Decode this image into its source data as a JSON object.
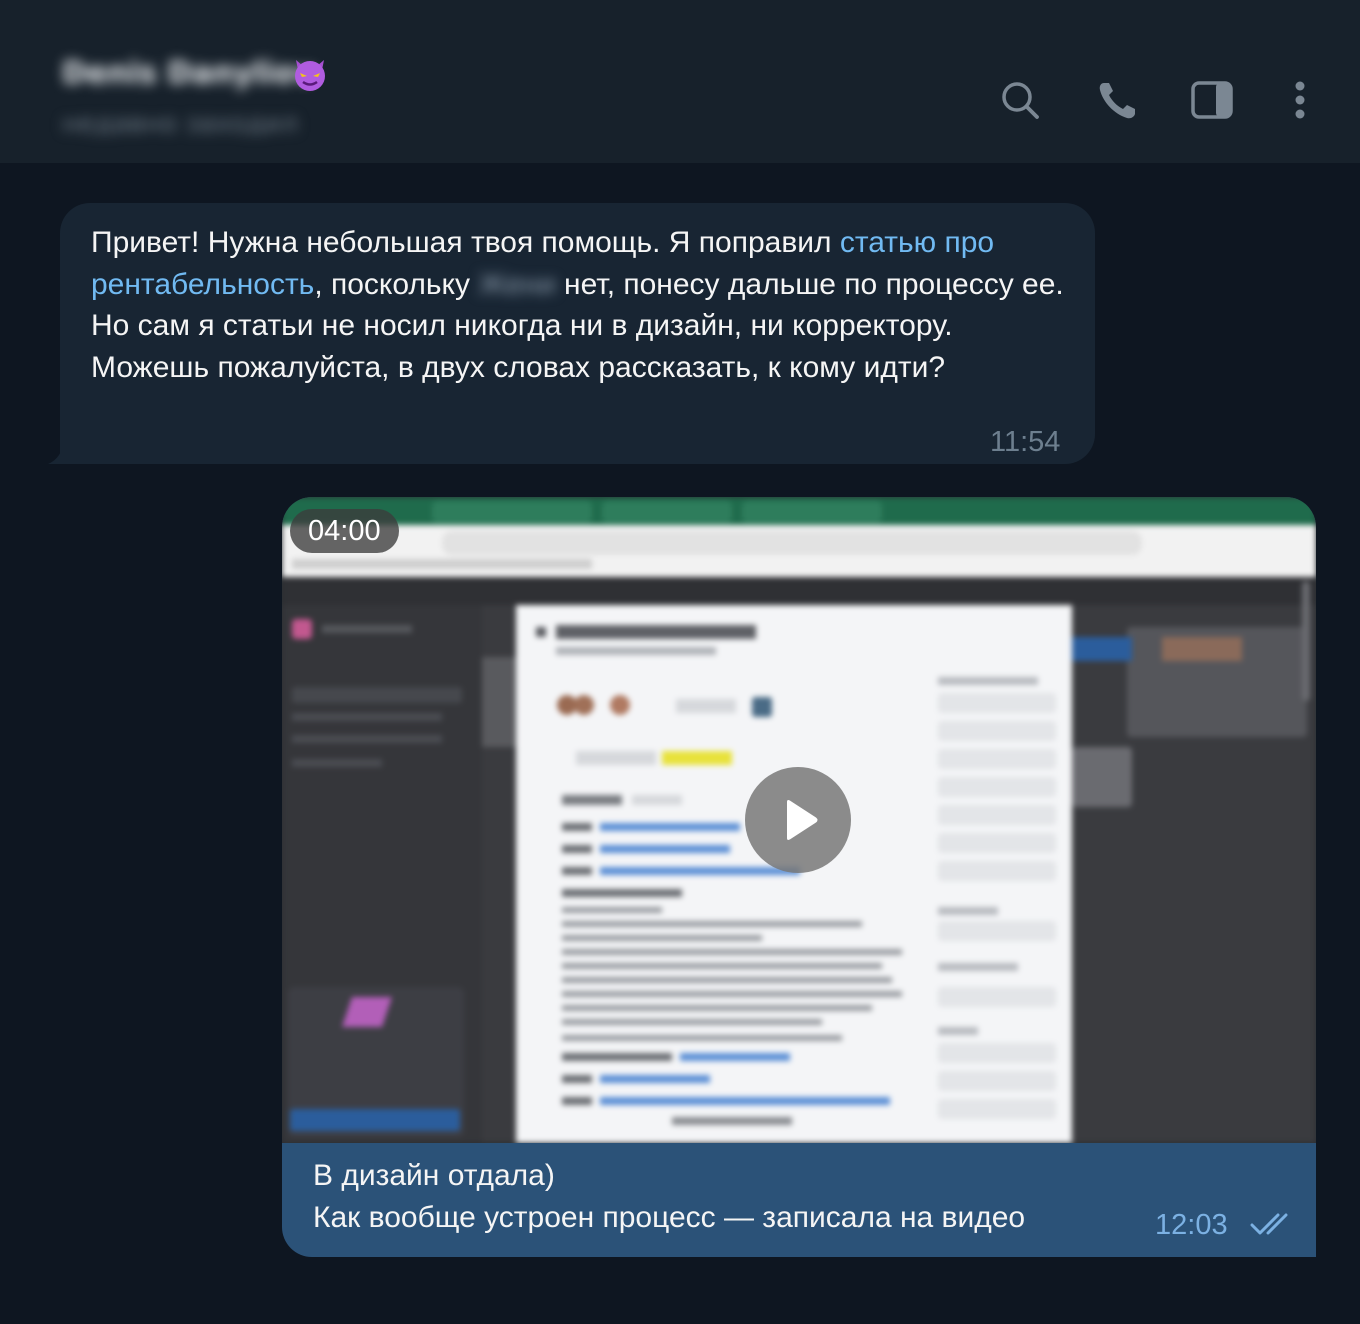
{
  "header": {
    "contact_name": "Denis Danyliov",
    "contact_status": "недавно заходил",
    "icons": [
      "search-icon",
      "phone-icon",
      "sidebar-toggle-icon",
      "more-vertical-icon"
    ]
  },
  "messages": {
    "incoming": {
      "text_before_link": "Привет! Нужна небольшая твоя помощь. Я поправил ",
      "link_text": "статью про рентабельность",
      "text_after_link": ", поскольку ",
      "redacted_name": "Жени",
      "text_after_name": " нет, понесу дальше по процессу ее. Но сам я статьи не носил никогда ни в дизайн, ни корректору. Можешь пожалуйста, в двух словах рассказать, к кому идти?",
      "time": "11:54"
    },
    "outgoing": {
      "video_duration": "04:00",
      "caption_line1": "В дизайн отдала)",
      "caption_line2": "Как вообще устроен процесс — записала на видео",
      "time": "12:03",
      "status": "read"
    }
  },
  "colors": {
    "background": "#0e1621",
    "header": "#17212b",
    "incoming_bubble": "#182533",
    "outgoing_bubble": "#2b5278",
    "link": "#71baf2"
  }
}
